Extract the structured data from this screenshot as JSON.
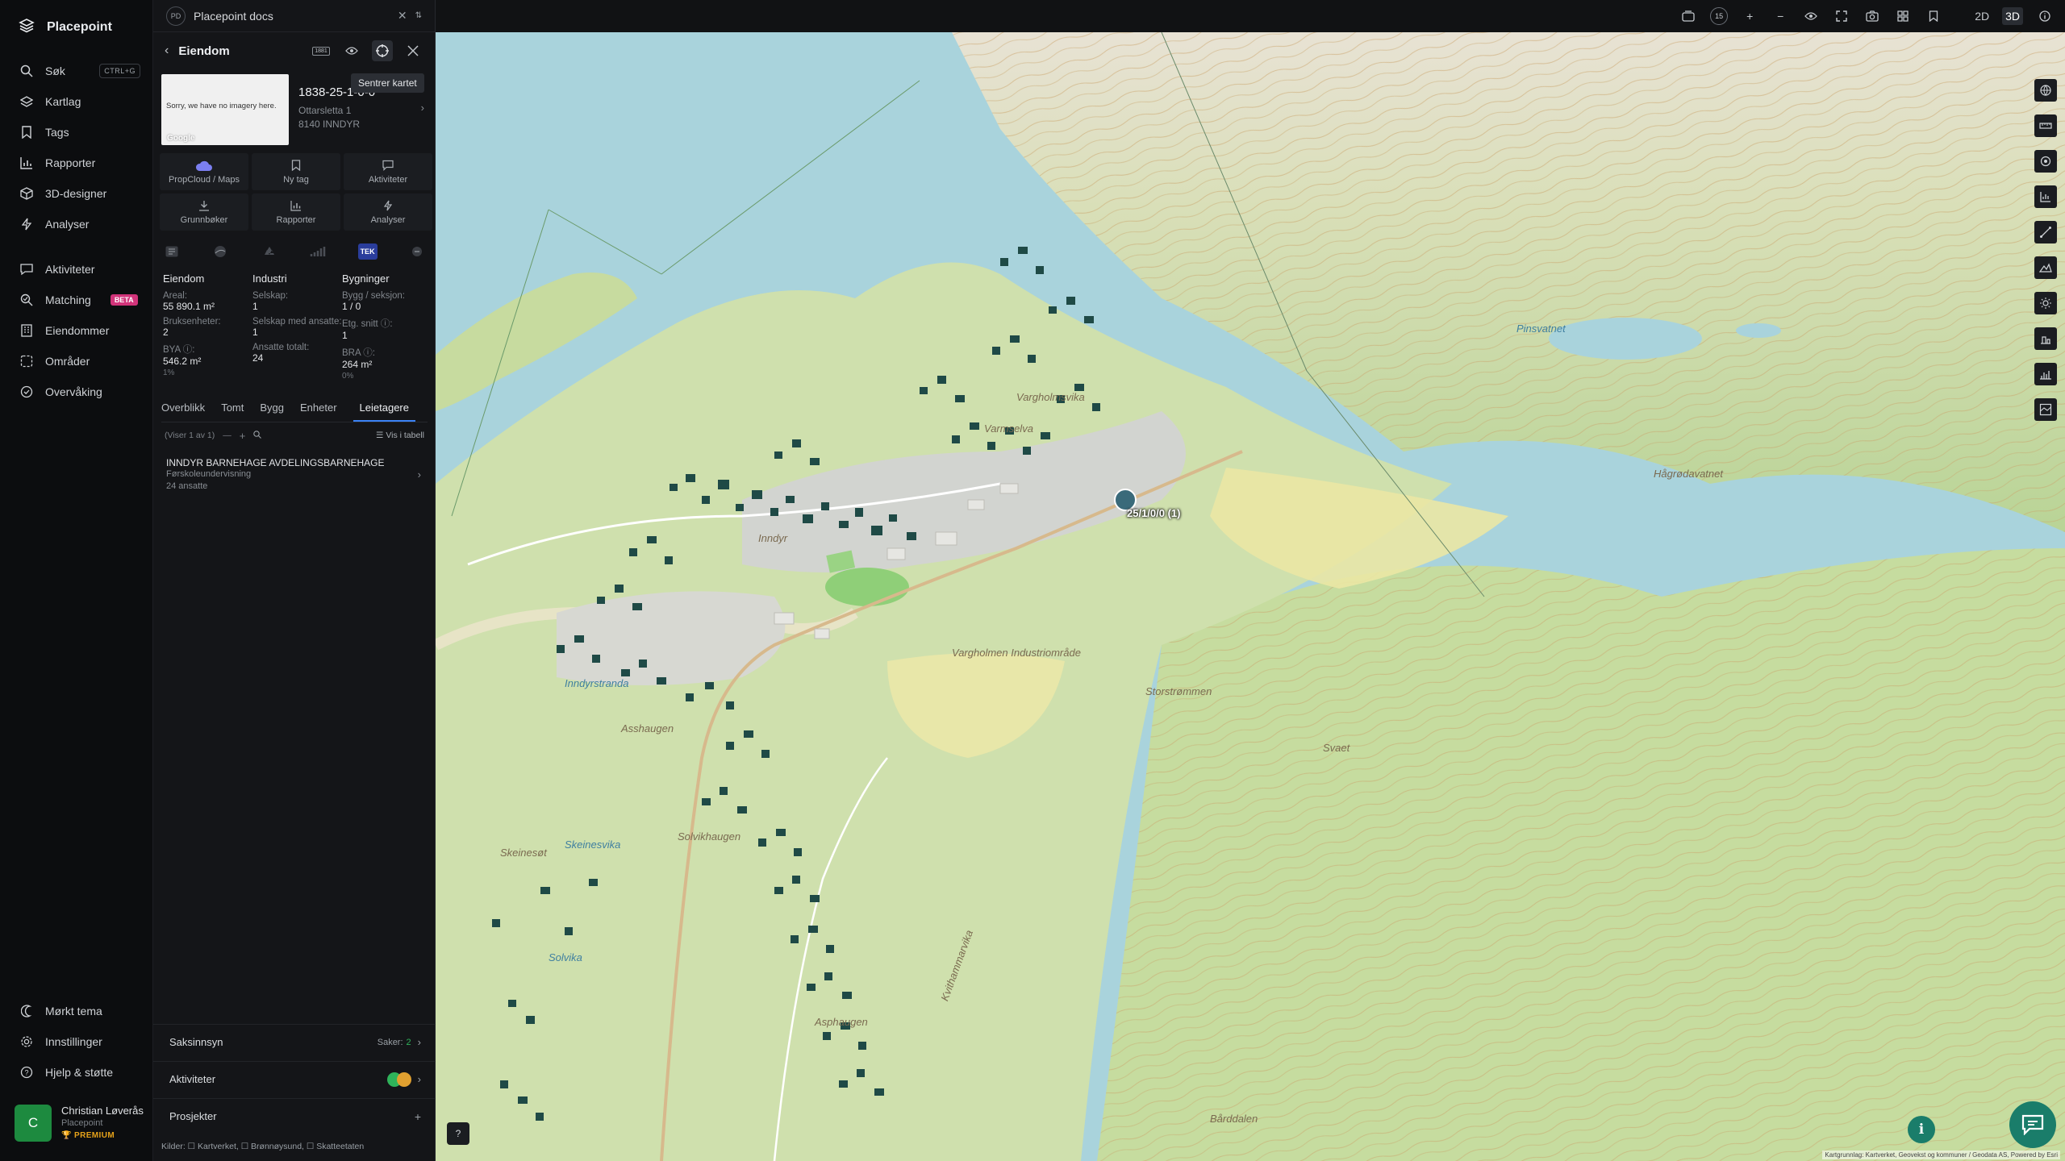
{
  "app": {
    "name": "Placepoint"
  },
  "nav": {
    "items": [
      {
        "label": "Søk",
        "shortcut": "CTRL+G",
        "icon": "search-icon"
      },
      {
        "label": "Kartlag",
        "icon": "layers-icon"
      },
      {
        "label": "Tags",
        "icon": "bookmark-icon"
      },
      {
        "label": "Rapporter",
        "icon": "chart-icon"
      },
      {
        "label": "3D-designer",
        "icon": "cube-icon"
      },
      {
        "label": "Analyser",
        "icon": "bolt-icon"
      },
      {
        "label": "Aktiviteter",
        "icon": "chat-icon"
      },
      {
        "label": "Matching",
        "badge": "BETA",
        "icon": "match-icon"
      },
      {
        "label": "Eiendommer",
        "icon": "building-icon"
      },
      {
        "label": "Områder",
        "icon": "area-icon"
      },
      {
        "label": "Overvåking",
        "icon": "monitor-icon"
      }
    ],
    "bottom": [
      {
        "label": "Mørkt tema",
        "icon": "moon-icon"
      },
      {
        "label": "Innstillinger",
        "icon": "gear-icon"
      },
      {
        "label": "Hjelp & støtte",
        "icon": "help-icon"
      }
    ],
    "user": {
      "initial": "C",
      "name": "Christian Løverås",
      "org": "Placepoint",
      "tier": "PREMIUM"
    }
  },
  "panel": {
    "doc_badge": "PD",
    "doc_title": "Placepoint docs",
    "title": "Eiendom",
    "tooltip": "Sentrer kartet",
    "header_badge": "1881",
    "thumb_msg": "Sorry, we have no imagery here.",
    "thumb_logo": "Google",
    "property_id": "1838-25-1-0-0",
    "address_line1": "Ottarsletta 1",
    "address_line2": "8140 INNDYR",
    "actions": [
      {
        "label": "PropCloud / Maps"
      },
      {
        "label": "Ny tag"
      },
      {
        "label": "Aktiviteter"
      },
      {
        "label": "Grunnbøker"
      },
      {
        "label": "Rapporter"
      },
      {
        "label": "Analyser"
      }
    ],
    "badge_tek": "TEK",
    "stats": {
      "col1": {
        "heading": "Eiendom",
        "l1": "Areal:",
        "v1": "55 890.1 m²",
        "l2": "Bruksenheter:",
        "v2": "2",
        "l3": "BYA ⓘ:",
        "v3": "546.2 m²",
        "s3": "1%"
      },
      "col2": {
        "heading": "Industri",
        "l1": "Selskap:",
        "v1": "1",
        "l2": "Selskap med ansatte:",
        "v2": "1",
        "l3": "Ansatte totalt:",
        "v3": "24"
      },
      "col3": {
        "heading": "Bygninger",
        "l1": "Bygg / seksjon:",
        "v1": "1 / 0",
        "l2": "Etg. snitt ⓘ:",
        "v2": "1",
        "l3": "BRA ⓘ:",
        "v3": "264 m²",
        "s3": "0%"
      }
    },
    "tabs": [
      "Overblikk",
      "Tomt",
      "Bygg",
      "Enheter",
      "Leietagere"
    ],
    "list_count": "(Viser 1 av 1)",
    "view_table": "Vis i tabell",
    "tenant": {
      "name": "INNDYR BARNEHAGE AVDELINGSBARNEHAGE",
      "type": "Førskoleundervisning",
      "employees": "24 ansatte"
    },
    "sections": {
      "saksinnsyn": "Saksinnsyn",
      "saker_label": "Saker:",
      "saker_count": "2",
      "aktiviteter": "Aktiviteter",
      "prosjekter": "Prosjekter"
    },
    "sources": "Kilder: ☐ Kartverket, ☐ Brønnøysund, ☐ Skatteetaten"
  },
  "topbar": {
    "badge": "15",
    "mode_2d": "2D",
    "mode_3d": "3D"
  },
  "map": {
    "marker_label": "25/1/0/0 (1)",
    "labels": [
      "Varmselva",
      "Vargholmsvika",
      "Asphaugen",
      "Kvithammarvika",
      "Inndyrstranda",
      "Asshaugen",
      "Solvikhaugen",
      "Skeinesvika",
      "Skeinesøt",
      "Solvika",
      "Svaet",
      "Bårddalen",
      "Storstrømmen",
      "Pinsvatnet",
      "Hågrødavatnet",
      "Inndyr",
      "Vargholmen Industriområde"
    ],
    "attribution": "Kartgrunnlag: Kartverket, Geovekst og kommuner / Geodata AS, Powered by Esri"
  }
}
